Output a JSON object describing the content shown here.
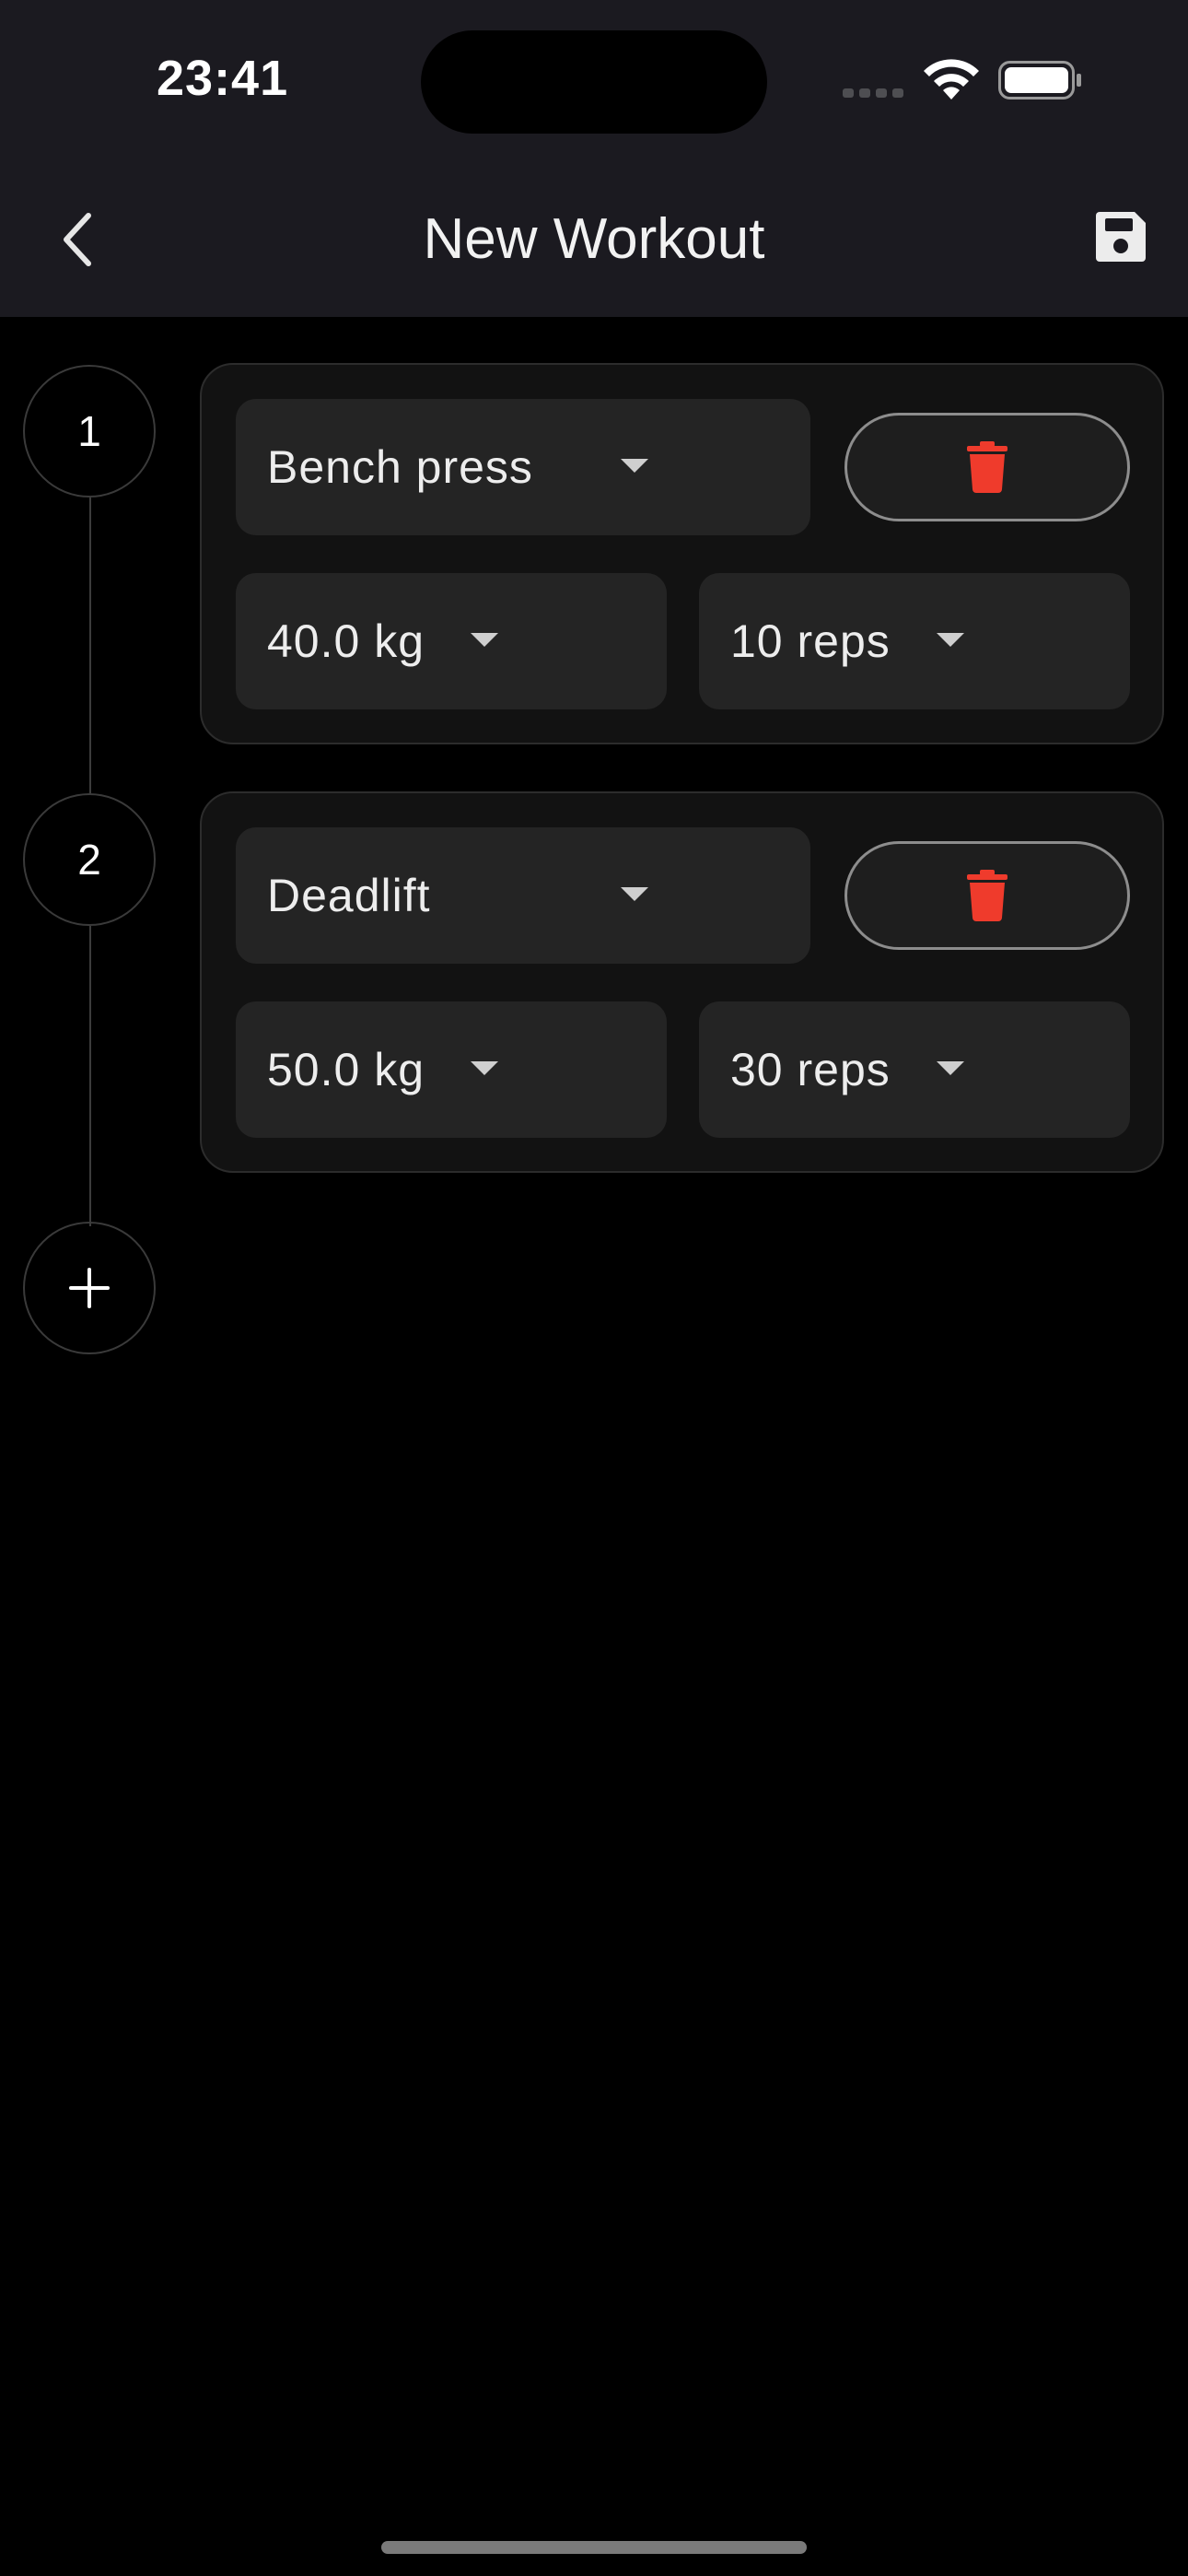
{
  "status_bar": {
    "time": "23:41"
  },
  "nav": {
    "title": "New Workout",
    "back_icon": "chevron-left-icon",
    "save_icon": "floppy-disk-icon"
  },
  "exercises": [
    {
      "index": "1",
      "exercise": "Bench press",
      "weight": "40.0 kg",
      "reps": "10 reps"
    },
    {
      "index": "2",
      "exercise": "Deadlift",
      "weight": "50.0 kg",
      "reps": "30 reps"
    }
  ],
  "add_step": {
    "icon": "plus-icon"
  },
  "colors": {
    "delete_red": "#ef3b2c",
    "header_bg": "#1b1a20",
    "field_bg": "#242424"
  }
}
